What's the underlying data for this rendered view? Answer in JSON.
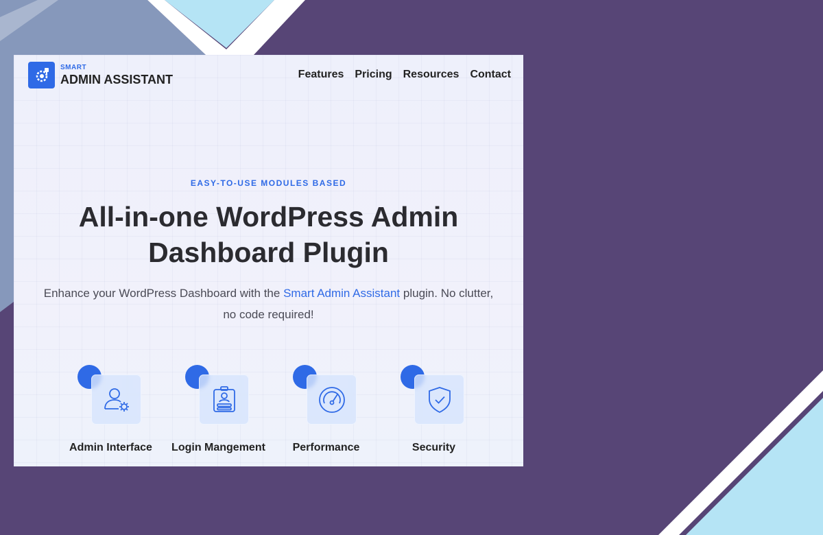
{
  "brand": {
    "small": "SMART",
    "big": "ADMIN ASSISTANT",
    "icon": "gear-puzzle-icon",
    "color": "#2f6ae6"
  },
  "nav": {
    "items": [
      "Features",
      "Pricing",
      "Resources",
      "Contact"
    ]
  },
  "hero": {
    "eyebrow": "EASY-TO-USE MODULES BASED",
    "title_line1": "All-in-one WordPress Admin",
    "title_line2": "Dashboard Plugin",
    "subtitle_before": "Enhance your WordPress Dashboard with the ",
    "subtitle_highlight": "Smart Admin Assistant",
    "subtitle_after": " plugin. No clutter,",
    "subtitle_line2": "no code required!"
  },
  "features": [
    {
      "label": "Admin Interface",
      "icon": "user-gear-icon"
    },
    {
      "label": "Login Mangement",
      "icon": "id-badge-icon"
    },
    {
      "label": "Performance",
      "icon": "speedometer-icon"
    },
    {
      "label": "Security",
      "icon": "shield-check-icon"
    }
  ],
  "colors": {
    "background": "#574576",
    "accent": "#2f6ae6",
    "light_blue": "#b5e4f5",
    "slate": "#8698bb"
  }
}
